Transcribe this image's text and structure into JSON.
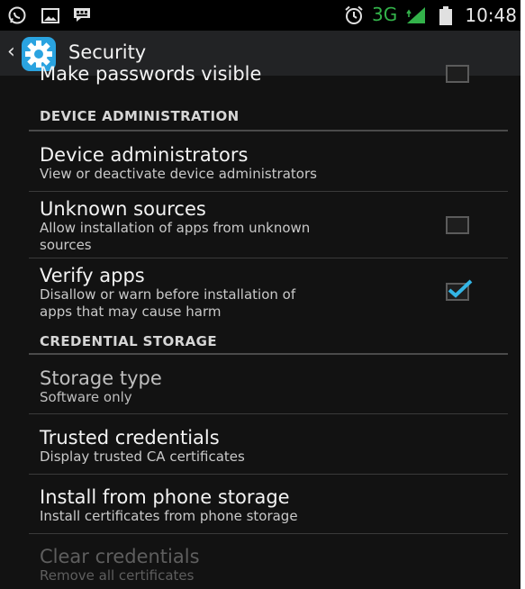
{
  "status_bar": {
    "network": "3G",
    "time": "10:48",
    "icons": [
      "whatsapp-icon",
      "image-icon",
      "bbm-icon",
      "alarm-icon",
      "signal-icon",
      "battery-icon"
    ]
  },
  "action_bar": {
    "title": "Security",
    "icon": "gear-icon"
  },
  "partial_item": {
    "title": "Make passwords visible",
    "checked": false
  },
  "sections": [
    {
      "header": "DEVICE ADMINISTRATION",
      "items": [
        {
          "title": "Device administrators",
          "subtitle": "View or deactivate device administrators"
        },
        {
          "title": "Unknown sources",
          "subtitle_lines": [
            "Allow installation of apps from unknown",
            "sources"
          ],
          "checked": false
        },
        {
          "title": "Verify apps",
          "subtitle_lines": [
            "Disallow or warn before installation of",
            "apps that may cause harm"
          ],
          "checked": true
        }
      ]
    },
    {
      "header": "CREDENTIAL STORAGE",
      "items": [
        {
          "title": "Storage type",
          "subtitle": "Software only"
        },
        {
          "title": "Trusted credentials",
          "subtitle": "Display trusted CA certificates"
        },
        {
          "title": "Install from phone storage",
          "subtitle": "Install certificates from phone storage"
        },
        {
          "title": "Clear credentials",
          "subtitle": "Remove all certificates",
          "enabled": false
        }
      ]
    }
  ],
  "colors": {
    "background": "#121212",
    "status_bar": "#000000",
    "action_bar": "#222325",
    "accent": "#33b5e5",
    "network_green": "#33b24a"
  }
}
